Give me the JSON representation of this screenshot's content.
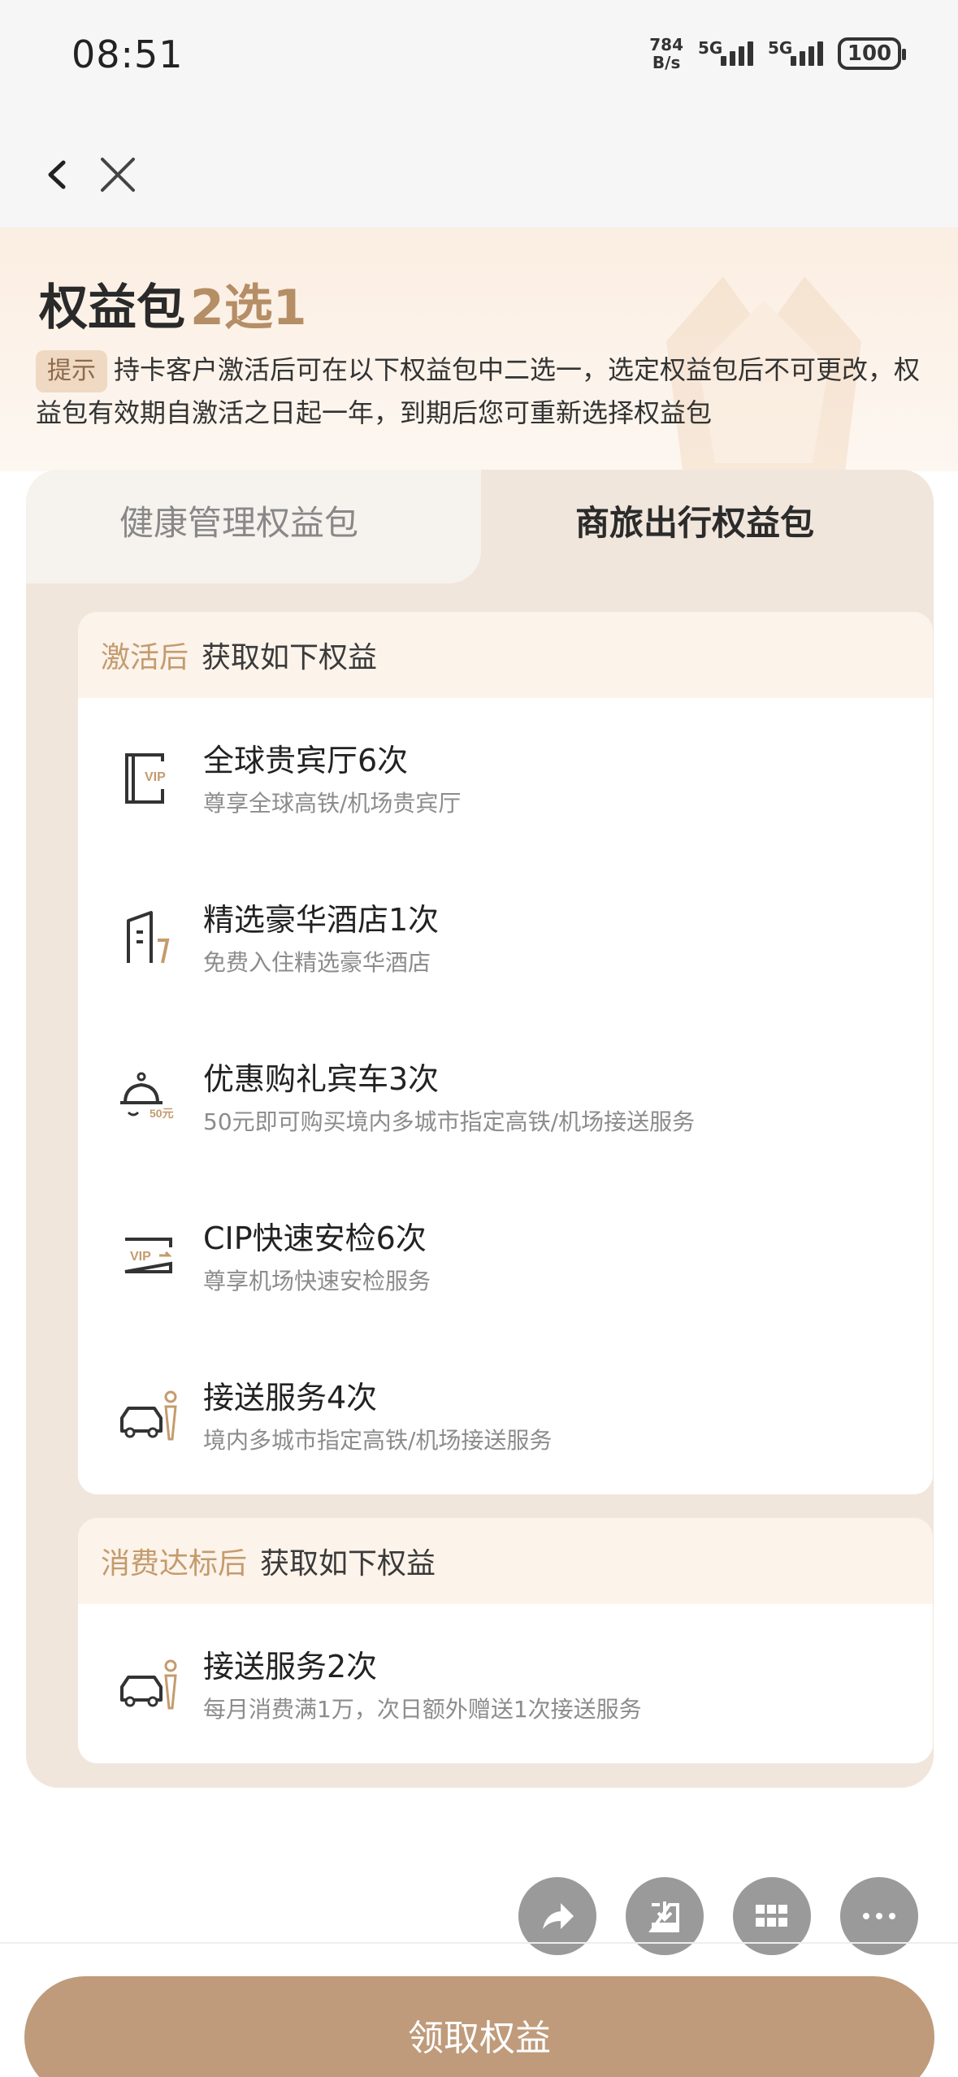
{
  "status": {
    "time": "08:51",
    "net_speed_top": "784",
    "net_speed_bottom": "B/s",
    "signal1_label": "5G",
    "signal2_label": "5G",
    "battery": "100"
  },
  "header": {
    "title_main": "权益包",
    "title_accent": "2选1",
    "tip_badge": "提示",
    "tip_text": "持卡客户激活后可在以下权益包中二选一，选定权益包后不可更改，权益包有效期自激活之日起一年，到期后您可重新选择权益包"
  },
  "tabs": [
    {
      "label": "健康管理权益包",
      "active": false
    },
    {
      "label": "商旅出行权益包",
      "active": true
    }
  ],
  "section1": {
    "head_accent": "激活后",
    "head_text": "获取如下权益",
    "items": [
      {
        "title": "全球贵宾厅6次",
        "subtitle": "尊享全球高铁/机场贵宾厅",
        "icon": "vip-lounge-icon"
      },
      {
        "title": "精选豪华酒店1次",
        "subtitle": "免费入住精选豪华酒店",
        "icon": "hotel-icon"
      },
      {
        "title": "优惠购礼宾车3次",
        "subtitle": "50元即可购买境内多城市指定高铁/机场接送服务",
        "icon": "car-coupon-icon"
      },
      {
        "title": "CIP快速安检6次",
        "subtitle": "尊享机场快速安检服务",
        "icon": "vip-security-icon"
      },
      {
        "title": "接送服务4次",
        "subtitle": "境内多城市指定高铁/机场接送服务",
        "icon": "chauffeur-icon"
      }
    ]
  },
  "section2": {
    "head_accent": "消费达标后",
    "head_text": "获取如下权益",
    "items": [
      {
        "title": "接送服务2次",
        "subtitle": "每月消费满1万，次日额外赠送1次接送服务",
        "icon": "chauffeur-icon"
      }
    ]
  },
  "icon_text": {
    "vip": "VIP",
    "coupon": "50元"
  },
  "fabs": [
    "share-icon",
    "download-icon",
    "grid-icon",
    "more-icon"
  ],
  "cta_label": "领取权益",
  "colors": {
    "accent": "#b58e66",
    "cta": "#bf9b7b",
    "panel": "#f1e6dc"
  }
}
